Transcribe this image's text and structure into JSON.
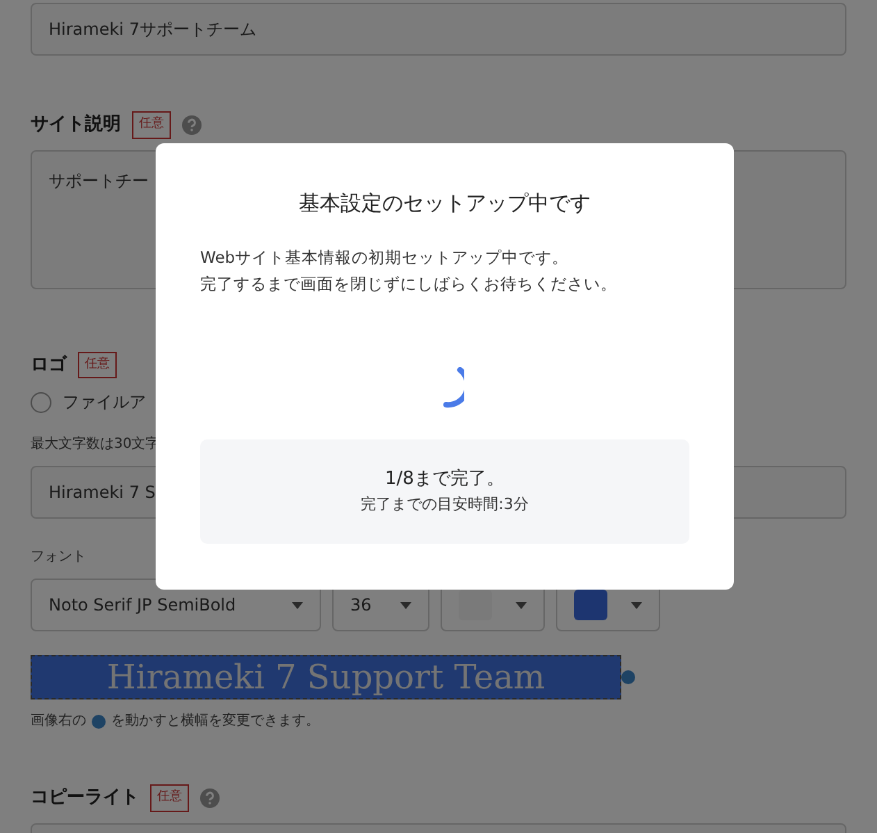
{
  "form": {
    "site_name": {
      "value": "Hirameki 7サポートチーム"
    },
    "site_description": {
      "label": "サイト説明",
      "badge": "任意",
      "value": "サポートチー"
    },
    "logo": {
      "label": "ロゴ",
      "badge": "任意",
      "option": {
        "label": "ファイルア",
        "checked": false
      },
      "hint": "最大文字数は30文字",
      "text_value": "Hirameki 7 S",
      "font_label": "フォント",
      "font": "Noto Serif JP SemiBold",
      "size": "36",
      "banner_text": "Hirameki 7 Support Team",
      "note_before": "画像右の",
      "note_after": "を動かすと横幅を変更できます。"
    },
    "copyright": {
      "label": "コピーライト",
      "badge": "任意"
    }
  },
  "modal": {
    "title": "基本設定のセットアップ中です",
    "message": [
      "Webサイト基本情報の初期セットアップ中です。",
      "完了するまで画面を閉じずにしばらくお待ちください。"
    ],
    "progress": "1/8まで完了。",
    "estimate": "完了までの目安時間:3分"
  }
}
